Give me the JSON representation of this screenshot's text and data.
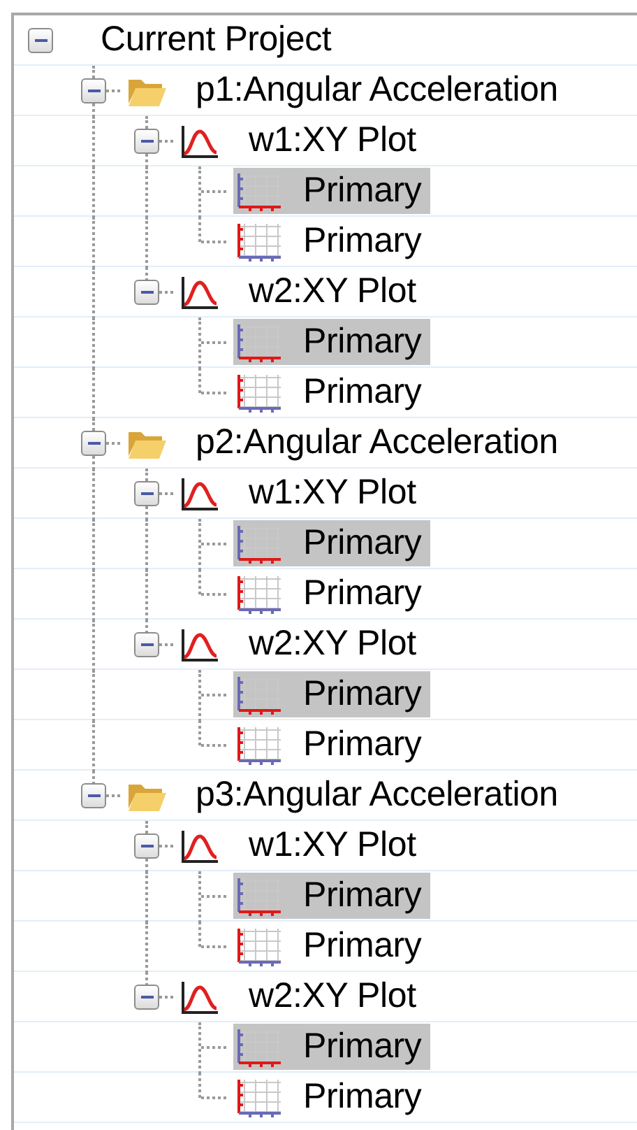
{
  "tree": {
    "label": "Current Project",
    "expanded": true,
    "children": [
      {
        "label": "p1:Angular Acceleration",
        "kind": "page",
        "expanded": true,
        "children": [
          {
            "label": "w1:XY Plot",
            "kind": "plot",
            "expanded": true,
            "children": [
              {
                "label": "Primary",
                "kind": "x-axis",
                "selected": true
              },
              {
                "label": "Primary",
                "kind": "y-axis",
                "selected": false
              }
            ]
          },
          {
            "label": "w2:XY Plot",
            "kind": "plot",
            "expanded": true,
            "children": [
              {
                "label": "Primary",
                "kind": "x-axis",
                "selected": true
              },
              {
                "label": "Primary",
                "kind": "y-axis",
                "selected": false
              }
            ]
          }
        ]
      },
      {
        "label": "p2:Angular Acceleration",
        "kind": "page",
        "expanded": true,
        "children": [
          {
            "label": "w1:XY Plot",
            "kind": "plot",
            "expanded": true,
            "children": [
              {
                "label": "Primary",
                "kind": "x-axis",
                "selected": true
              },
              {
                "label": "Primary",
                "kind": "y-axis",
                "selected": false
              }
            ]
          },
          {
            "label": "w2:XY Plot",
            "kind": "plot",
            "expanded": true,
            "children": [
              {
                "label": "Primary",
                "kind": "x-axis",
                "selected": true
              },
              {
                "label": "Primary",
                "kind": "y-axis",
                "selected": false
              }
            ]
          }
        ]
      },
      {
        "label": "p3:Angular Acceleration",
        "kind": "page",
        "expanded": true,
        "children": [
          {
            "label": "w1:XY Plot",
            "kind": "plot",
            "expanded": true,
            "children": [
              {
                "label": "Primary",
                "kind": "x-axis",
                "selected": true
              },
              {
                "label": "Primary",
                "kind": "y-axis",
                "selected": false
              }
            ]
          },
          {
            "label": "w2:XY Plot",
            "kind": "plot",
            "expanded": true,
            "children": [
              {
                "label": "Primary",
                "kind": "x-axis",
                "selected": true
              },
              {
                "label": "Primary",
                "kind": "y-axis",
                "selected": false
              }
            ]
          }
        ]
      }
    ]
  }
}
